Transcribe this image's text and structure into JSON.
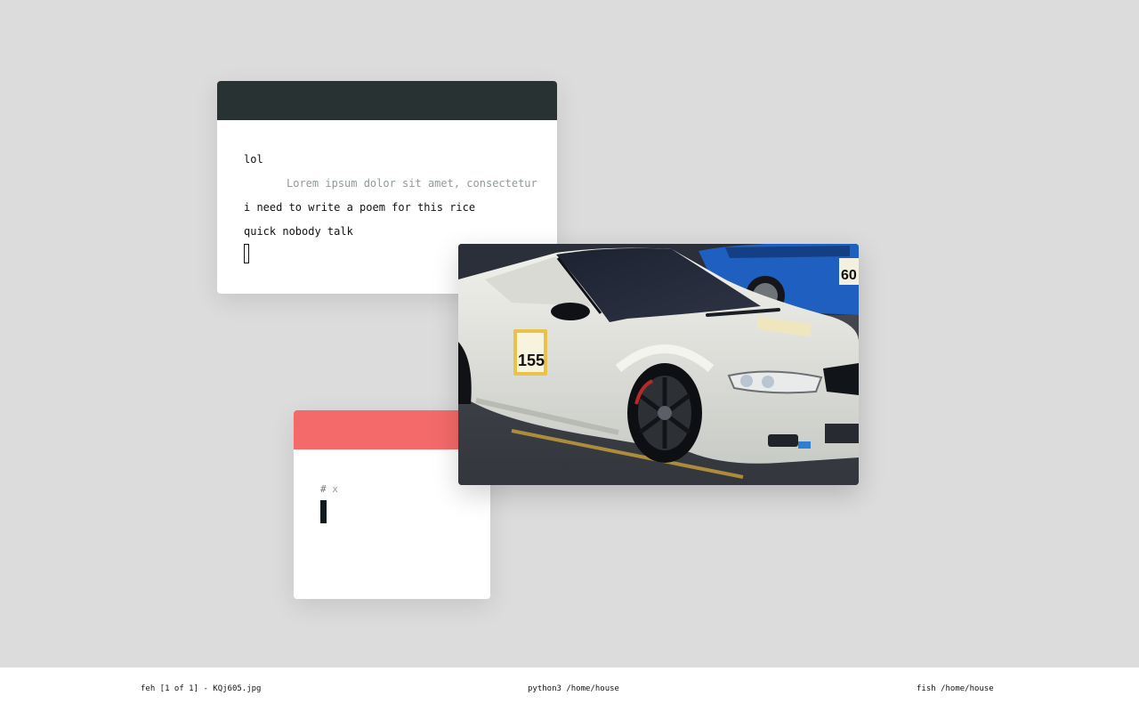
{
  "chat_window": {
    "lines": [
      "lol",
      "Lorem ipsum dolor sit amet, consectetur",
      "i need to write a poem for this rice",
      "quick nobody talk"
    ],
    "colors": {
      "titlebar": "#283232",
      "background": "#ffffff"
    }
  },
  "image_window": {
    "subject": "white BMW E46 race car with number 155 plate, blue car in background",
    "plate_number": "155",
    "background_plate": "60"
  },
  "terminal_window": {
    "prompt_symbol": "#",
    "prompt_text": "x",
    "colors": {
      "titlebar": "#f46a6a",
      "background": "#ffffff"
    }
  },
  "taskbar": {
    "items": [
      "feh [1 of 1] - KQj605.jpg",
      "python3 /home/house",
      "fish /home/house"
    ]
  }
}
